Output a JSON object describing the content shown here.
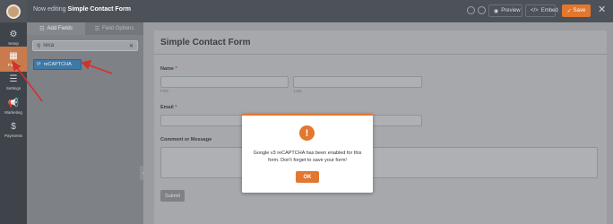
{
  "header": {
    "title_prefix": "Now editing",
    "title_form": "Simple Contact Form",
    "preview_label": "Preview",
    "embed_label": "Embed",
    "save_label": "Save"
  },
  "nav": {
    "items": [
      {
        "label": "Setup",
        "icon": "gear-icon"
      },
      {
        "label": "Fields",
        "icon": "fields-icon",
        "active": true
      },
      {
        "label": "Settings",
        "icon": "sliders-icon"
      },
      {
        "label": "Marketing",
        "icon": "megaphone-icon"
      },
      {
        "label": "Payments",
        "icon": "dollar-icon"
      }
    ]
  },
  "panel": {
    "tab_add": "Add Fields",
    "tab_options": "Field Options",
    "search_value": "reca",
    "result_label": "reCAPTCHA"
  },
  "form": {
    "title": "Simple Contact Form",
    "name_label": "Name",
    "first_label": "First",
    "last_label": "Last",
    "email_label": "Email",
    "comment_label": "Comment or Message",
    "required_mark": "*",
    "submit_label": "Submit"
  },
  "modal": {
    "message": "Google v3 reCAPTCHA has been enabled for this form. Don't forget to save your form!",
    "ok_label": "OK"
  },
  "colors": {
    "accent": "#e27730",
    "field_button": "#3f79a6",
    "arrow": "#d6302a"
  }
}
